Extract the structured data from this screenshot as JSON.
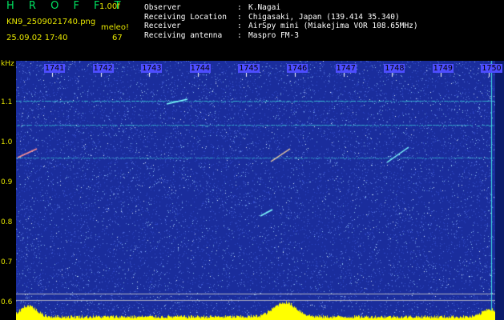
{
  "header": {
    "brand": "H R O F F T",
    "version": "1.00f",
    "filename": "KN9_2509021740.png",
    "meleo": "meleo!",
    "datetime": "25.09.02 17:40",
    "count": "67",
    "info": [
      {
        "label": "Observer",
        "sep": ":",
        "value": "K.Nagai"
      },
      {
        "label": "Receiving Location",
        "sep": ":",
        "value": "Chigasaki, Japan (139.414 35.340)"
      },
      {
        "label": "Receiver",
        "sep": ":",
        "value": "AirSpy mini (Miakejima VOR 108.65MHz)"
      },
      {
        "label": "Receiving antenna",
        "sep": ":",
        "value": "Maspro FM-3"
      }
    ]
  },
  "axis": {
    "y_unit": "kHz",
    "y_ticks": [
      "1.1",
      "1.0",
      "0.9",
      "0.8",
      "0.7",
      "0.6"
    ],
    "x_ticks": [
      "1741",
      "1742",
      "1743",
      "1744",
      "1745",
      "1746",
      "1747",
      "1748",
      "1749",
      "1750"
    ]
  },
  "colors": {
    "background": "#1a2d9c",
    "trace": "#40e0e0",
    "label_yellow": "#e6e600",
    "brand_green": "#00e060",
    "spectrum_yellow": "#ffff00"
  }
}
